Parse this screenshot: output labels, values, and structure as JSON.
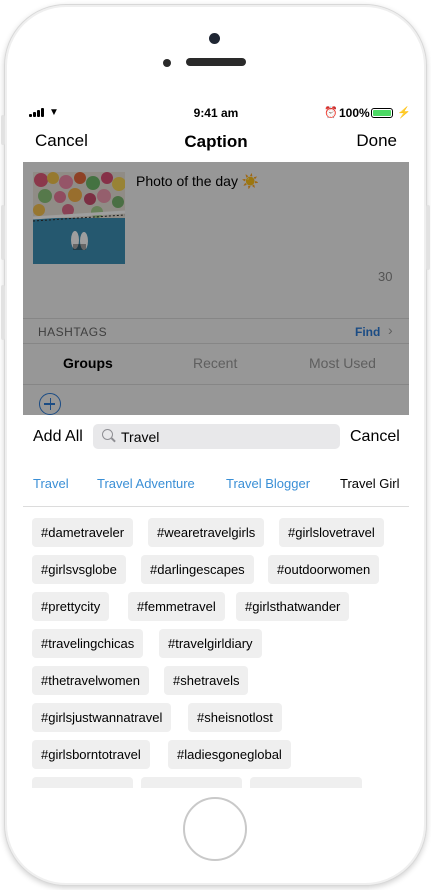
{
  "status": {
    "time": "9:41 am",
    "battery": "100%",
    "battery_color": "#4cd964"
  },
  "nav": {
    "cancel": "Cancel",
    "title": "Caption",
    "done": "Done"
  },
  "post": {
    "caption": "Photo of the day ☀️",
    "counter": "30"
  },
  "hashtags_section": {
    "label": "HASHTAGS",
    "find": "Find"
  },
  "tabs": [
    "Groups",
    "Recent",
    "Most Used"
  ],
  "search": {
    "add_all": "Add All",
    "value": "Travel",
    "cancel": "Cancel"
  },
  "suggestions": [
    "Travel",
    "Travel Adventure",
    "Travel Blogger",
    "Travel Girl"
  ],
  "hashtags": [
    "#dametraveler",
    "#wearetravelgirls",
    "#girlslovetravel",
    "#girlsvsglobe",
    "#darlingescapes",
    "#outdoorwomen",
    "#prettycity",
    "#femmetravel",
    "#girlsthatwander",
    "#travelingchicas",
    "#travelgirldiary",
    "#thetravelwomen",
    "#shetravels",
    "#girlsjustwannatravel",
    "#sheisnotlost",
    "#girlsborntotravel",
    "#ladiesgoneglobal"
  ],
  "colors": {
    "accent": "#2d7bd6",
    "chip_text": "#3a8fd6",
    "tag_bg": "#efefef"
  }
}
